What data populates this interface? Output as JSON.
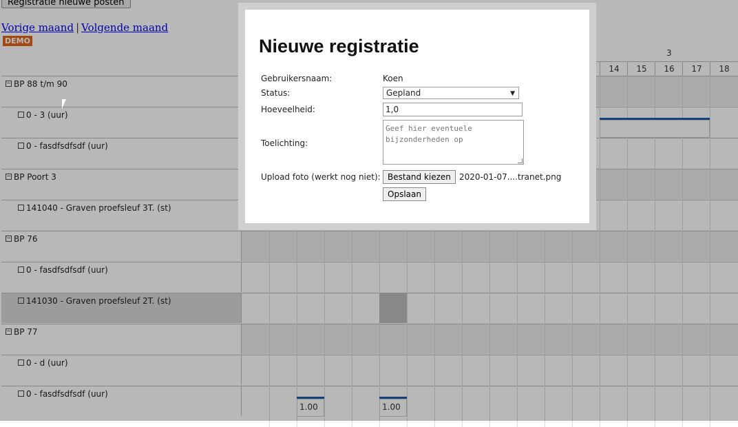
{
  "toolbar": {
    "register_label": "Registratie nieuwe posten"
  },
  "nav": {
    "prev": "Vorige maand",
    "sep": "|",
    "next": "Volgende maand"
  },
  "badge": {
    "demo": "DEMO"
  },
  "calendar": {
    "week_label": "3",
    "days": [
      "14",
      "15",
      "16",
      "17",
      "18"
    ],
    "rows": [
      {
        "type": "group",
        "label": "BP 88 t/m 90"
      },
      {
        "type": "item",
        "label": "0 - 3 (uur)"
      },
      {
        "type": "item",
        "label": "0 - fasdfsdfsdf (uur)"
      },
      {
        "type": "group",
        "label": "BP Poort 3"
      },
      {
        "type": "item",
        "label": "141040 - Graven proefsleuf 3T. (st)"
      },
      {
        "type": "group",
        "label": "BP 76"
      },
      {
        "type": "item",
        "label": "0 - fasdfsdfsdf (uur)"
      },
      {
        "type": "item",
        "label": "141030 - Graven proefsleuf 2T. (st)"
      },
      {
        "type": "group",
        "label": "BP 77"
      },
      {
        "type": "item",
        "label": "0 - d (uur)"
      },
      {
        "type": "item",
        "label": "0 - fasdfsdfsdf (uur)"
      }
    ],
    "cell_values": [
      "1.00",
      "1.00"
    ]
  },
  "modal": {
    "title": "Nieuwe registratie",
    "username_label": "Gebruikersnaam:",
    "username_value": "Koen",
    "status_label": "Status:",
    "status_value": "Gepland",
    "quantity_label": "Hoeveelheid:",
    "quantity_value": "1,0",
    "note_label": "Toelichting:",
    "note_placeholder": "Geef hier eventuele bijzonderheden op",
    "upload_label": "Upload foto (werkt nog niet):",
    "file_button": "Bestand kiezen",
    "file_name": "2020-01-07....tranet.png",
    "save_button": "Opslaan"
  }
}
